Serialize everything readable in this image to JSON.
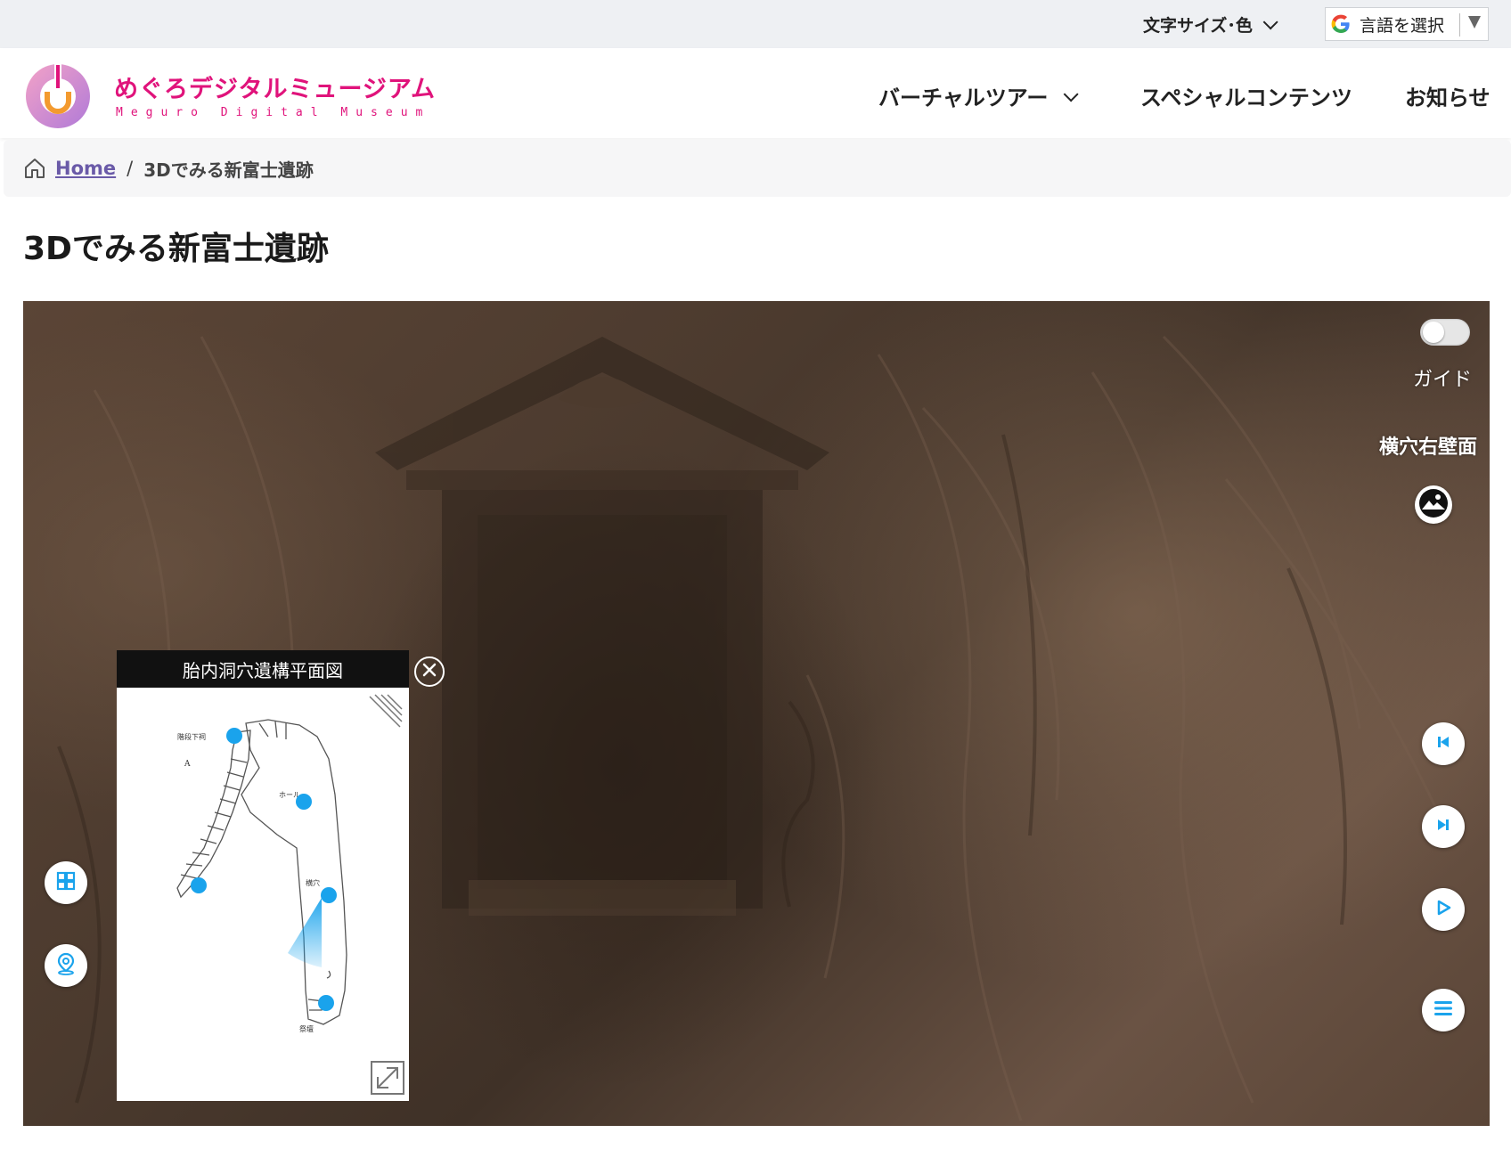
{
  "utility": {
    "font_size_color": "文字サイズ･色",
    "language_select": "言語を選択"
  },
  "logo": {
    "title": "めぐろデジタルミュージアム",
    "subtitle": "Meguro Digital Museum"
  },
  "nav": {
    "virtual_tour": "バーチャルツアー",
    "special_contents": "スペシャルコンテンツ",
    "news": "お知らせ"
  },
  "breadcrumb": {
    "home": "Home",
    "separator": "/",
    "current": "3Dでみる新富士遺跡"
  },
  "page_title": "3Dでみる新富士遺跡",
  "viewer": {
    "guide_label": "ガイド",
    "guide_toggle_on": false,
    "location_label": "横穴右壁面",
    "map_title": "胎内洞穴遺構平面図",
    "map_labels": {
      "stairs": "階段下祠",
      "north": "A",
      "hall": "ホール",
      "side_cave": "横穴",
      "altar": "祭壇"
    }
  },
  "colors": {
    "brand_pink": "#e0137b",
    "brand_purple": "#9b5ed0",
    "accent_blue": "#1aa3ec",
    "breadcrumb_link": "#6a5aa8"
  },
  "icons": {
    "font_size_chevron": "chevron-down-icon",
    "google_logo": "google-icon",
    "home": "home-icon",
    "image": "image-icon",
    "previous": "skip-previous-icon",
    "next": "skip-next-icon",
    "play": "play-icon",
    "menu": "menu-icon",
    "grid": "grid-icon",
    "map_pin": "map-pin-icon",
    "close": "close-icon",
    "expand": "expand-icon"
  }
}
